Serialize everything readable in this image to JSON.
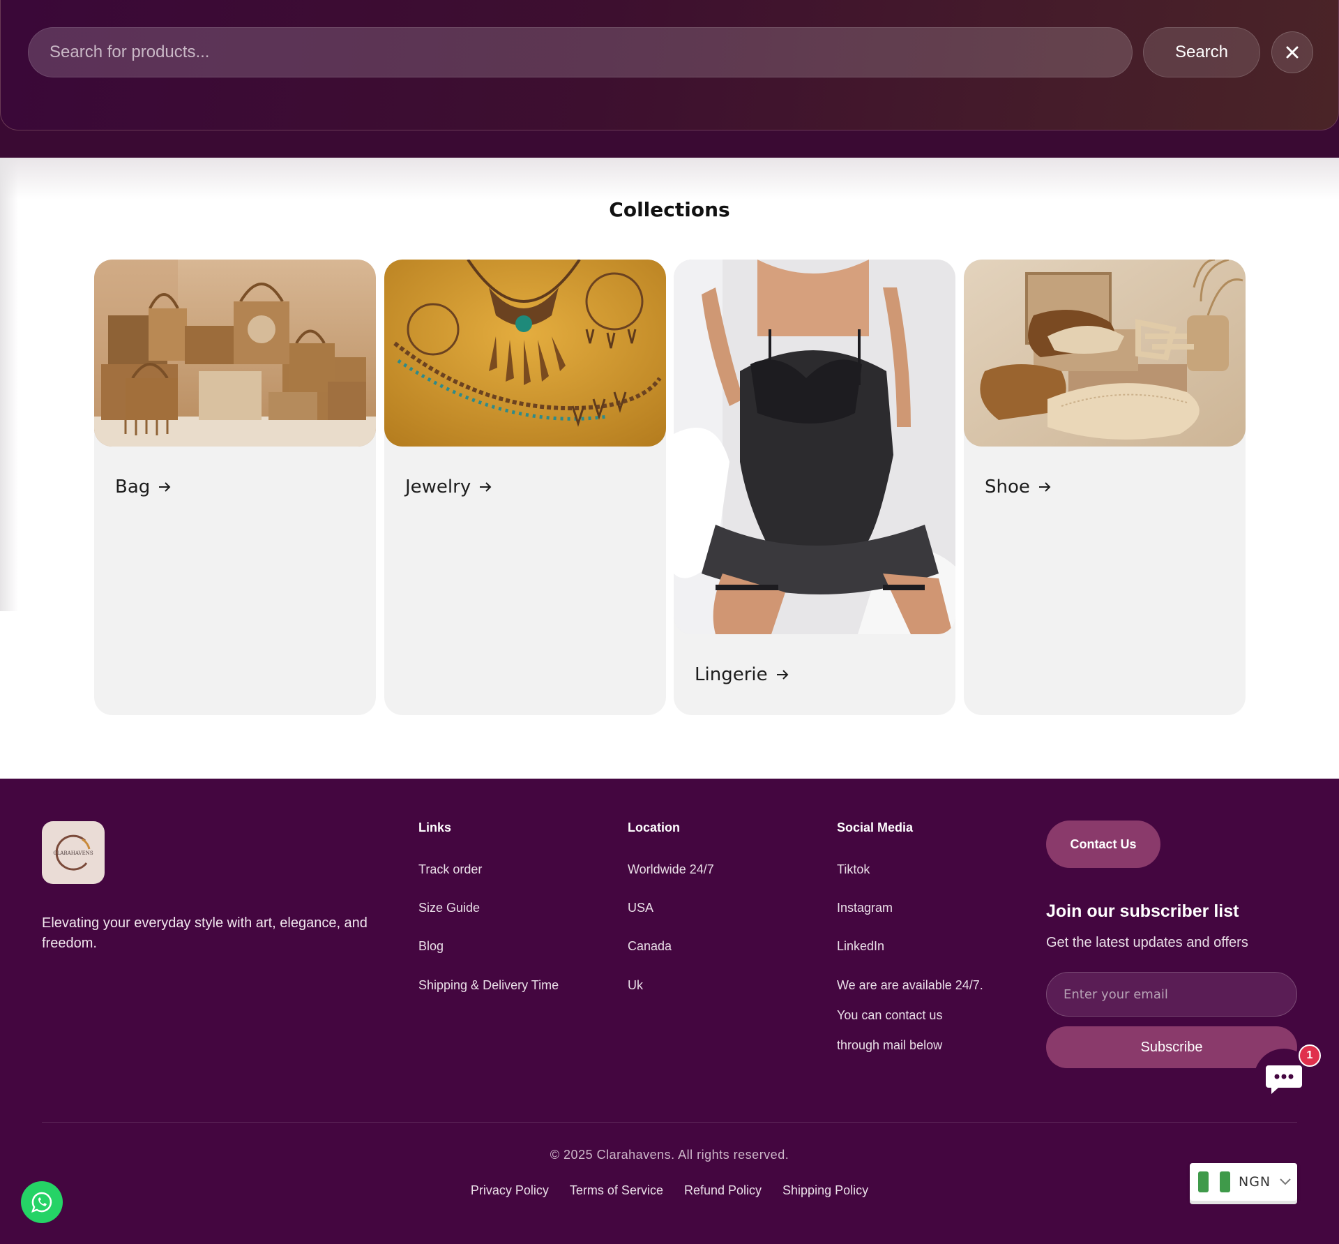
{
  "search": {
    "placeholder": "Search for products...",
    "button_label": "Search",
    "close_icon": "close-icon"
  },
  "collections": {
    "title": "Collections",
    "items": [
      {
        "label": "Bag",
        "icon": "arrow-right-icon"
      },
      {
        "label": "Jewelry",
        "icon": "arrow-right-icon"
      },
      {
        "label": "Lingerie",
        "icon": "arrow-right-icon"
      },
      {
        "label": "Shoe",
        "icon": "arrow-right-icon"
      }
    ]
  },
  "footer": {
    "logo_text": "CLARAHAVENS",
    "tagline": "Elevating your everyday style with art, elegance, and freedom.",
    "links": {
      "heading": "Links",
      "items": [
        "Track order",
        "Size Guide",
        "Blog",
        "Shipping & Delivery Time"
      ]
    },
    "location": {
      "heading": "Location",
      "items": [
        "Worldwide 24/7",
        "USA",
        "Canada",
        "Uk"
      ]
    },
    "social": {
      "heading": "Social Media",
      "items": [
        "Tiktok",
        "Instagram",
        "LinkedIn"
      ],
      "availability": [
        "We are are available 24/7.",
        "You can contact us",
        "through mail below"
      ]
    },
    "contact_button": "Contact Us",
    "subscribe": {
      "title": "Join our subscriber list",
      "subtitle": "Get the latest updates and offers",
      "email_placeholder": "Enter your email",
      "button_label": "Subscribe"
    },
    "copyright": "© 2025 Clarahavens. All rights reserved.",
    "policies": [
      "Privacy Policy",
      "Terms of Service",
      "Refund Policy",
      "Shipping Policy"
    ]
  },
  "widgets": {
    "whatsapp_icon": "whatsapp-icon",
    "chat_icon": "chat-bubble-icon",
    "chat_badge": "1",
    "currency": "NGN",
    "currency_flag": "nigeria-flag-icon"
  },
  "colors": {
    "brand_purple": "#440640",
    "accent_plum": "#8a3a6b",
    "whatsapp_green": "#25d366",
    "badge_red": "#e0314d"
  }
}
